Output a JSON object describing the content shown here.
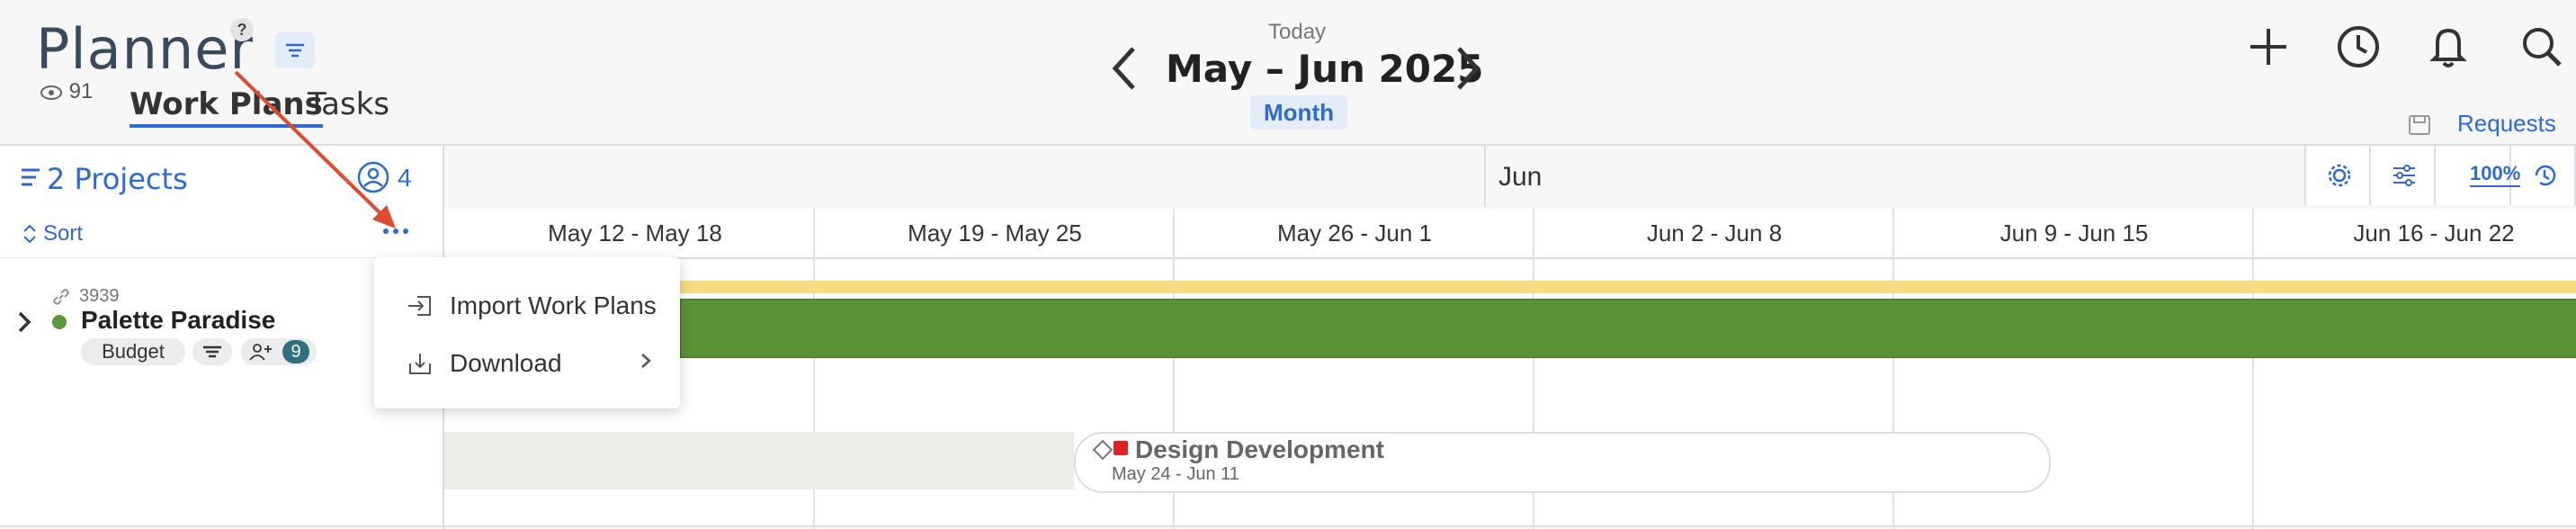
{
  "header": {
    "title": "Planner",
    "help": "?",
    "views_count": "91",
    "tabs": [
      {
        "label": "Work Plans",
        "active": true
      },
      {
        "label": "Tasks",
        "active": false
      }
    ],
    "today_label": "Today",
    "date_range": "May – Jun 2025",
    "view_mode": "Month",
    "requests_label": "Requests"
  },
  "left_panel": {
    "projects_label": "2 Projects",
    "members_count": "4",
    "sort_label": "Sort",
    "project": {
      "id": "3939",
      "name": "Palette Paradise",
      "tag": "Budget",
      "assignee_count": "9"
    }
  },
  "timeline": {
    "month_label": "Jun",
    "zoom": "100%",
    "weeks": [
      "May 12 - May 18",
      "May 19 - May 25",
      "May 26 - Jun 1",
      "Jun 2 - Jun 8",
      "Jun 9 - Jun 15",
      "Jun 16 - Jun 22"
    ],
    "phase": {
      "name": "Design Development",
      "dates": "May 24 - Jun 11"
    }
  },
  "menu": {
    "items": [
      {
        "label": "Import Work Plans"
      },
      {
        "label": "Download"
      }
    ]
  },
  "colors": {
    "accent": "#2e6ad1",
    "bar_green": "#5b9237",
    "bar_yellow": "#f7dd7f",
    "annotation_arrow": "#e04a2e"
  }
}
